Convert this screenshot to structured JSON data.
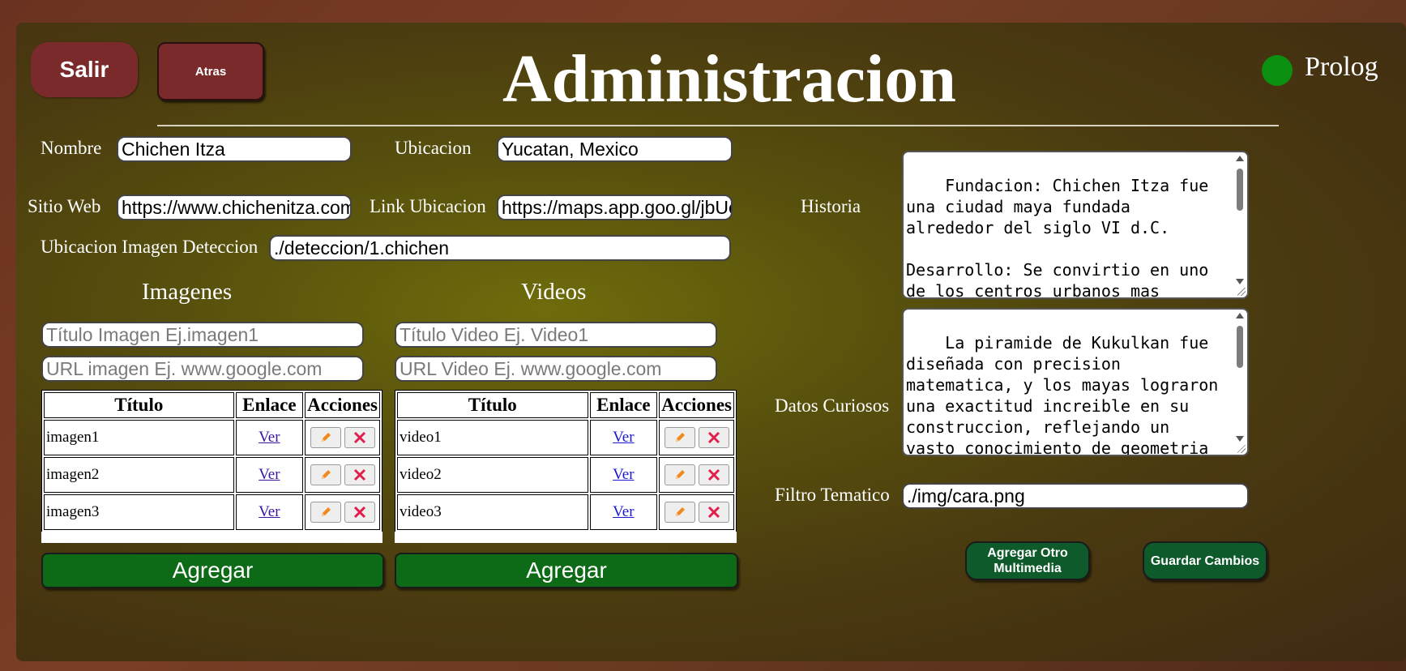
{
  "header": {
    "exit_label": "Salir",
    "back_label": "Atras",
    "title": "Administracion",
    "status_label": "Prolog",
    "status_color": "#0a8f10"
  },
  "form": {
    "nombre_label": "Nombre",
    "nombre_value": "Chichen Itza",
    "ubicacion_label": "Ubicacion",
    "ubicacion_value": "Yucatan, Mexico",
    "sitio_web_label": "Sitio Web",
    "sitio_web_value": "https://www.chichenitza.com",
    "link_ubicacion_label": "Link Ubicacion",
    "link_ubicacion_value": "https://maps.app.goo.gl/jbUc",
    "imagen_deteccion_label": "Ubicacion Imagen Deteccion",
    "imagen_deteccion_value": "./deteccion/1.chichen",
    "historia_label": "Historia",
    "historia_value": "Fundacion: Chichen Itza fue una ciudad maya fundada alrededor del siglo VI d.C.\n\nDesarrollo: Se convirtio en uno de los centros urbanos mas importantes y prosperos de la",
    "datos_curiosos_label": "Datos Curiosos",
    "datos_curiosos_value": "La piramide de Kukulkan fue diseñada con precision matematica, y los mayas lograron una exactitud increible en su construccion, reflejando un vasto conocimiento de geometria y astronomia.",
    "filtro_label": "Filtro Tematico",
    "filtro_value": "./img/cara.png"
  },
  "imagenes": {
    "section_title": "Imagenes",
    "title_placeholder": "Título Imagen Ej.imagen1",
    "url_placeholder": "URL imagen Ej. www.google.com",
    "columns": [
      "Título",
      "Enlace",
      "Acciones"
    ],
    "rows": [
      {
        "titulo": "imagen1",
        "enlace": "Ver"
      },
      {
        "titulo": "imagen2",
        "enlace": "Ver"
      },
      {
        "titulo": "imagen3",
        "enlace": "Ver"
      }
    ],
    "add_label": "Agregar"
  },
  "videos": {
    "section_title": "Videos",
    "title_placeholder": "Título Video Ej. Video1",
    "url_placeholder": "URL Video Ej. www.google.com",
    "columns": [
      "Título",
      "Enlace",
      "Acciones"
    ],
    "rows": [
      {
        "titulo": "video1",
        "enlace": "Ver"
      },
      {
        "titulo": "video2",
        "enlace": "Ver"
      },
      {
        "titulo": "video3",
        "enlace": "Ver"
      }
    ],
    "add_label": "Agregar"
  },
  "footer": {
    "add_multimedia_label": "Agregar Otro Multimedia",
    "save_label": "Guardar Cambios"
  },
  "icons": {
    "edit": "pencil-icon",
    "delete": "close-icon"
  },
  "colors": {
    "exit_button": "#7b2a2c",
    "primary_green": "#0d6a16",
    "edit_icon": "#f08a1c",
    "delete_icon": "#e0204a"
  }
}
